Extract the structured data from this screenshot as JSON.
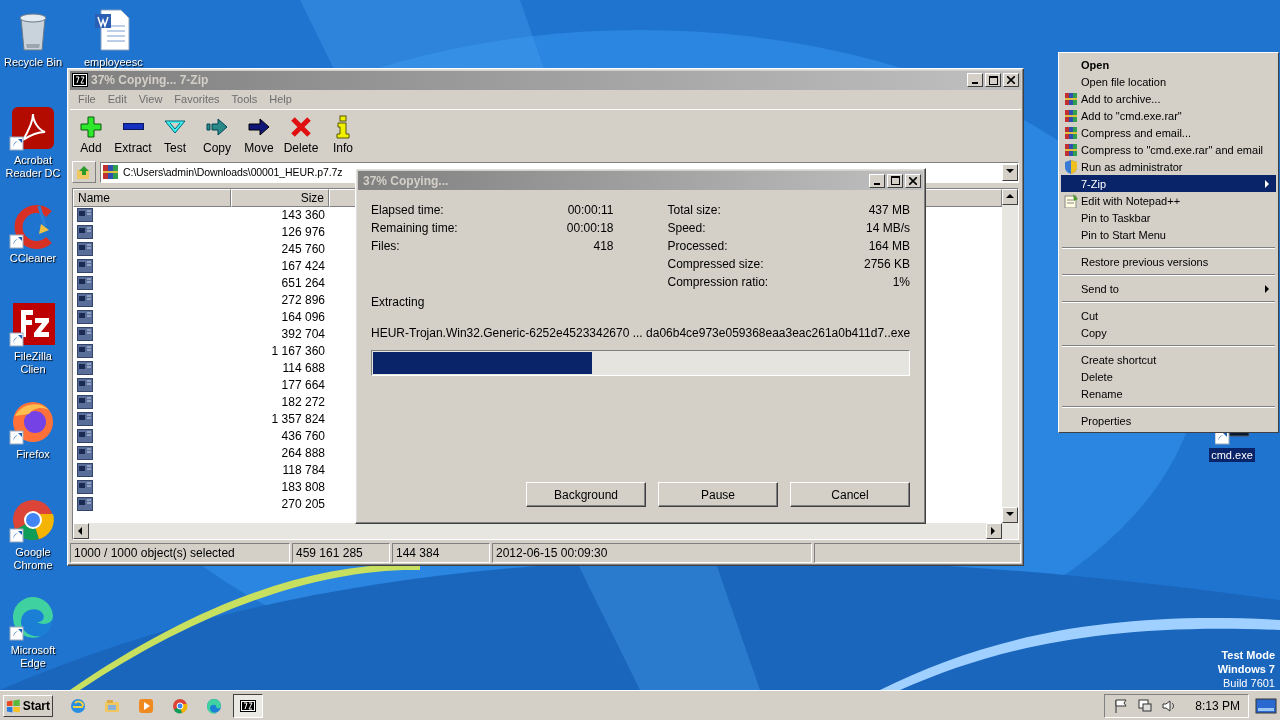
{
  "desktop_icons": [
    {
      "label": "Recycle Bin",
      "kind": "recycle",
      "shortcut": false
    },
    {
      "label": "Acrobat Reader DC",
      "kind": "acrobat",
      "shortcut": true
    },
    {
      "label": "CCleaner",
      "kind": "ccleaner",
      "shortcut": true
    },
    {
      "label": "FileZilla Clien",
      "kind": "filezilla",
      "shortcut": true
    },
    {
      "label": "Firefox",
      "kind": "firefox",
      "shortcut": true
    },
    {
      "label": "Google Chrome",
      "kind": "chrome",
      "shortcut": true
    },
    {
      "label": "Microsoft Edge",
      "kind": "edge",
      "shortcut": true
    }
  ],
  "desktop_file": {
    "label": "employeesc",
    "kind": "word",
    "shortcut": false
  },
  "archive_window": {
    "title": "37% Copying... 7-Zip",
    "active": false,
    "menu": [
      "File",
      "Edit",
      "View",
      "Favorites",
      "Tools",
      "Help"
    ],
    "toolbar": [
      {
        "label": "Add",
        "kind": "add"
      },
      {
        "label": "Extract",
        "kind": "extract"
      },
      {
        "label": "Test",
        "kind": "test"
      },
      {
        "label": "Copy",
        "kind": "copy"
      },
      {
        "label": "Move",
        "kind": "move"
      },
      {
        "label": "Delete",
        "kind": "delete"
      },
      {
        "label": "Info",
        "kind": "info"
      }
    ],
    "path": "C:\\Users\\admin\\Downloads\\00001_HEUR.p7.7z",
    "columns": [
      "Name",
      "Size"
    ],
    "rows": [
      {
        "size": "143 360"
      },
      {
        "size": "126 976"
      },
      {
        "size": "245 760"
      },
      {
        "size": "167 424"
      },
      {
        "size": "651 264"
      },
      {
        "size": "272 896"
      },
      {
        "size": "164 096"
      },
      {
        "size": "392 704"
      },
      {
        "size": "1 167 360"
      },
      {
        "size": "114 688"
      },
      {
        "size": "177 664"
      },
      {
        "size": "182 272"
      },
      {
        "size": "1 357 824"
      },
      {
        "size": "436 760"
      },
      {
        "size": "264 888"
      },
      {
        "size": "118 784"
      },
      {
        "size": "183 808"
      },
      {
        "size": "270 205"
      }
    ],
    "status": [
      "1000 / 1000 object(s) selected",
      "459 161 285",
      "144 384",
      "2012-06-15 00:09:30"
    ]
  },
  "progress_dialog": {
    "title": "37% Copying...",
    "active": false,
    "stats_left": [
      {
        "label": "Elapsed time:",
        "value": "00:00:11"
      },
      {
        "label": "Remaining time:",
        "value": "00:00:18"
      },
      {
        "label": "Files:",
        "value": "418"
      }
    ],
    "stats_right": [
      {
        "label": "Total size:",
        "value": "437 MB"
      },
      {
        "label": "Speed:",
        "value": "14 MB/s"
      },
      {
        "label": "Processed:",
        "value": "164 MB"
      },
      {
        "label": "Compressed size:",
        "value": "2756 KB"
      },
      {
        "label": "Compression ratio:",
        "value": "1%"
      }
    ],
    "operation": "Extracting",
    "current_file": "HEUR-Trojan.Win32.Generic-6252e4523342670 ... da06b4ce973e059368eaa3eac261a0b411d7..exe",
    "level": 0.41,
    "buttons": [
      "Background",
      "Pause",
      "Cancel"
    ]
  },
  "context_menu": {
    "items": [
      {
        "kind": "plain",
        "label": "Open",
        "default": true,
        "submenu": false,
        "selected": false
      },
      {
        "kind": "plain",
        "label": "Open file location",
        "default": false,
        "submenu": false,
        "selected": false
      },
      {
        "kind": "archive",
        "label": "Add to archive...",
        "default": false,
        "submenu": false,
        "selected": false
      },
      {
        "kind": "archive",
        "label": "Add to \"cmd.exe.rar\"",
        "default": false,
        "submenu": false,
        "selected": false
      },
      {
        "kind": "archive",
        "label": "Compress and email...",
        "default": false,
        "submenu": false,
        "selected": false
      },
      {
        "kind": "archive",
        "label": "Compress to \"cmd.exe.rar\" and email",
        "default": false,
        "submenu": false,
        "selected": false
      },
      {
        "kind": "shield",
        "label": "Run as administrator",
        "default": false,
        "submenu": false,
        "selected": false
      },
      {
        "kind": "plain",
        "label": "7-Zip",
        "default": false,
        "submenu": true,
        "selected": true
      },
      {
        "kind": "notepad",
        "label": "Edit with Notepad++",
        "default": false,
        "submenu": false,
        "selected": false
      },
      {
        "kind": "plain",
        "label": "Pin to Taskbar",
        "default": false,
        "submenu": false,
        "selected": false
      },
      {
        "kind": "plain",
        "label": "Pin to Start Menu",
        "default": false,
        "submenu": false,
        "selected": false
      },
      {
        "kind": "separator"
      },
      {
        "kind": "plain",
        "label": "Restore previous versions",
        "default": false,
        "submenu": false,
        "selected": false
      },
      {
        "kind": "separator"
      },
      {
        "kind": "plain",
        "label": "Send to",
        "default": false,
        "submenu": true,
        "selected": false
      },
      {
        "kind": "separator"
      },
      {
        "kind": "plain",
        "label": "Cut",
        "default": false,
        "submenu": false,
        "selected": false
      },
      {
        "kind": "plain",
        "label": "Copy",
        "default": false,
        "submenu": false,
        "selected": false
      },
      {
        "kind": "separator"
      },
      {
        "kind": "plain",
        "label": "Create shortcut",
        "default": false,
        "submenu": false,
        "selected": false
      },
      {
        "kind": "plain",
        "label": "Delete",
        "default": false,
        "submenu": false,
        "selected": false
      },
      {
        "kind": "plain",
        "label": "Rename",
        "default": false,
        "submenu": false,
        "selected": false
      },
      {
        "kind": "separator"
      },
      {
        "kind": "plain",
        "label": "Properties",
        "default": false,
        "submenu": false,
        "selected": false
      }
    ]
  },
  "cmd_icon": {
    "label": "cmd.exe",
    "selected": true
  },
  "system_watermark": [
    "Test Mode",
    "Windows 7",
    "Build 7601"
  ],
  "taskbar": {
    "start": "Start",
    "apps": [
      {
        "kind": "ie",
        "active": false
      },
      {
        "kind": "explorer",
        "active": false
      },
      {
        "kind": "media",
        "active": false
      },
      {
        "kind": "chrome",
        "active": false
      },
      {
        "kind": "edge",
        "active": false
      },
      {
        "kind": "sevenzip",
        "active": true
      }
    ],
    "clock": "8:13 PM"
  }
}
